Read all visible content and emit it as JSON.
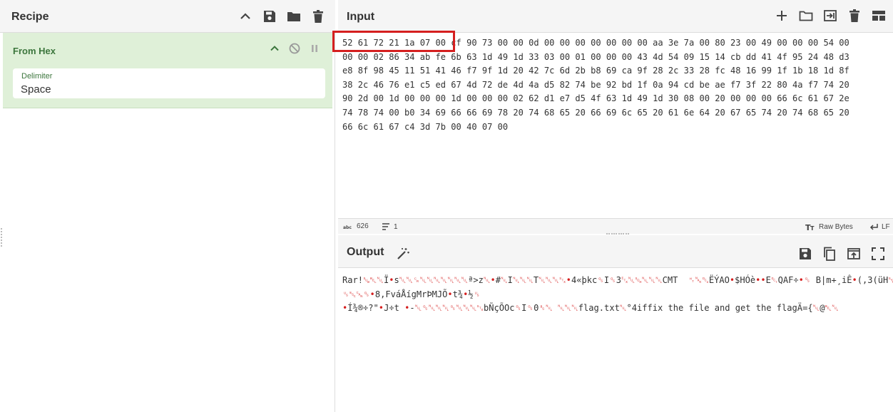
{
  "recipe": {
    "title": "Recipe",
    "operation": {
      "name": "From Hex",
      "field_label": "Delimiter",
      "field_value": "Space"
    }
  },
  "input": {
    "title": "Input",
    "lines": [
      "52 61 72 21 1a 07 00 cf 90 73 00 00 0d 00 00 00 00 00 00 00 aa 3e 7a 00 80 23 00 49 00 00 00 54 00",
      "00 00 02 86 34 ab fe 6b 63 1d 49 1d 33 03 00 01 00 00 00 43 4d 54 09 15 14 cb dd 41 4f 95 24 48 d3",
      "e8 8f 98 45 11 51 41 46 f7 9f 1d 20 42 7c 6d 2b b8 69 ca 9f 28 2c 33 28 fc 48 16 99 1f 1b 18 1d 8f",
      "38 2c 46 76 e1 c5 ed 67 4d 72 de 4d 4a d5 82 74 be 92 bd 1f 0a 94 cd be ae f7 3f 22 80 4a f7 74 20",
      "90 2d 00 1d 00 00 00 1d 00 00 00 02 62 d1 e7 d5 4f 63 1d 49 1d 30 08 00 20 00 00 00 66 6c 61 67 2e",
      "74 78 74 00 b0 34 69 66 66 69 78 20 74 68 65 20 66 69 6c 65 20 61 6e 64 20 67 65 74 20 74 68 65 20",
      "66 6c 61 67 c4 3d 7b 00 40 07 00"
    ],
    "status": {
      "length": "626",
      "lines": "1",
      "encoding": "Raw Bytes",
      "eol": "LF"
    }
  },
  "output": {
    "title": "Output",
    "line1": [
      {
        "t": "Rar!",
        "r": false
      },
      {
        "t": "␚␇␀",
        "r": true
      },
      {
        "t": "Ï",
        "r": false
      },
      {
        "t": "•",
        "r": true
      },
      {
        "t": "s",
        "r": false
      },
      {
        "t": "␀␀␍␀␀␀␀␀␀␀",
        "r": true
      },
      {
        "t": "ª>z",
        "r": false
      },
      {
        "t": "␀•",
        "r": true
      },
      {
        "t": "#",
        "r": false
      },
      {
        "t": "␀",
        "r": true
      },
      {
        "t": "I",
        "r": false
      },
      {
        "t": "␀␀␀",
        "r": true
      },
      {
        "t": "T",
        "r": false
      },
      {
        "t": "␀␀␀␂•",
        "r": true
      },
      {
        "t": "4«þkc",
        "r": false
      },
      {
        "t": "␝",
        "r": true
      },
      {
        "t": "I",
        "r": false
      },
      {
        "t": "␝",
        "r": true
      },
      {
        "t": "3",
        "r": false
      },
      {
        "t": "␃␀␁␀␀␀",
        "r": true
      },
      {
        "t": "CMT  ",
        "r": false
      },
      {
        "t": "␉␕␔",
        "r": true
      },
      {
        "t": "ËÝAO",
        "r": false
      },
      {
        "t": "•",
        "r": true
      },
      {
        "t": "$HÓè",
        "r": false
      },
      {
        "t": "••",
        "r": true
      },
      {
        "t": "E",
        "r": false
      },
      {
        "t": "␑",
        "r": true
      },
      {
        "t": "QAF÷",
        "r": false
      },
      {
        "t": "•␝",
        "r": true
      },
      {
        "t": " B|m+¸iÊ",
        "r": false
      },
      {
        "t": "•",
        "r": true
      },
      {
        "t": "(,3(üH",
        "r": false
      },
      {
        "t": "␖•",
        "r": true
      }
    ],
    "line2": [
      {
        "t": "␟␛␘␝•",
        "r": true
      },
      {
        "t": "8,FváÅígMrÞMJÕ",
        "r": false
      },
      {
        "t": "•",
        "r": true
      },
      {
        "t": "t¾",
        "r": false
      },
      {
        "t": "•",
        "r": true
      },
      {
        "t": "½",
        "r": false
      },
      {
        "t": "␟",
        "r": true
      }
    ],
    "line3": [
      {
        "t": "•",
        "r": true
      },
      {
        "t": "Í¾®÷?\"",
        "r": false
      },
      {
        "t": "•",
        "r": true
      },
      {
        "t": "J÷t ",
        "r": false
      },
      {
        "t": "•",
        "r": true
      },
      {
        "t": "-",
        "r": false
      },
      {
        "t": "␀␝␀␀␀␝␀␀␀␂",
        "r": true
      },
      {
        "t": "bÑçÕOc",
        "r": false
      },
      {
        "t": "␝",
        "r": true
      },
      {
        "t": "I",
        "r": false
      },
      {
        "t": "␝",
        "r": true
      },
      {
        "t": "0",
        "r": false
      },
      {
        "t": "␈␀",
        "r": true
      },
      {
        "t": " ",
        "r": false
      },
      {
        "t": "␀␀␀",
        "r": true
      },
      {
        "t": "flag.txt",
        "r": false
      },
      {
        "t": "␀",
        "r": true
      },
      {
        "t": "°4iffix the file and get the flagÄ={",
        "r": false
      },
      {
        "t": "␀",
        "r": true
      },
      {
        "t": "@",
        "r": false
      },
      {
        "t": "␇␀",
        "r": true
      }
    ]
  }
}
